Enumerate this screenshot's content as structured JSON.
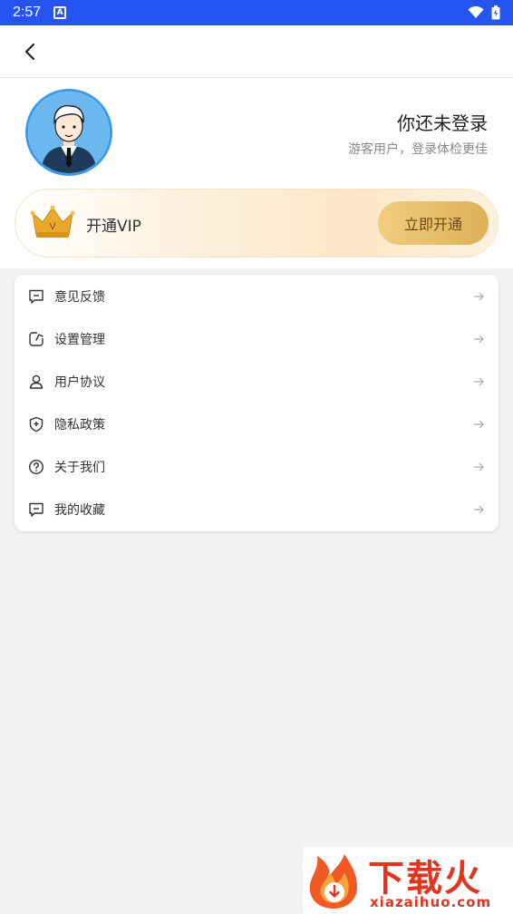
{
  "status_bar": {
    "time": "2:57",
    "notification_icon": "a-icon"
  },
  "profile": {
    "name": "你还未登录",
    "subtitle": "游客用户，登录体检更佳"
  },
  "vip": {
    "label": "开通VIP",
    "button_label": "立即开通",
    "crown_letter": "V"
  },
  "menu": {
    "items": [
      {
        "label": "意见反馈",
        "icon": "feedback-icon"
      },
      {
        "label": "设置管理",
        "icon": "settings-icon"
      },
      {
        "label": "用户协议",
        "icon": "user-icon"
      },
      {
        "label": "隐私政策",
        "icon": "shield-icon"
      },
      {
        "label": "关于我们",
        "icon": "help-icon"
      },
      {
        "label": "我的收藏",
        "icon": "favorites-icon"
      }
    ]
  },
  "watermark": {
    "text": "下载火",
    "domain": "xiazaihuo.com"
  },
  "colors": {
    "status_bar": "#2453f0",
    "vip_button": "#ddb057",
    "watermark": "#e3341f"
  }
}
